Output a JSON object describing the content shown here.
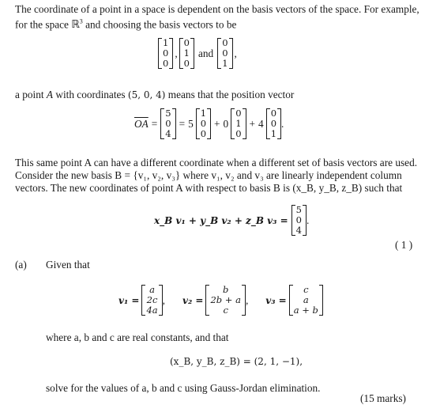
{
  "intro": {
    "line1": "The coordinate of a point in a space is dependent on the basis vectors of the space. For example,",
    "line2_a": "for the space ",
    "line2_space": "ℝ",
    "line2_sup": "3",
    "line2_b": " and choosing the basis vectors to be"
  },
  "basis_std": {
    "e1": [
      "1",
      "0",
      "0"
    ],
    "e2": [
      "0",
      "1",
      "0"
    ],
    "e3": [
      "0",
      "0",
      "1"
    ],
    "sep1": ",",
    "and": "and",
    "end": ","
  },
  "point_line": {
    "a": "a point ",
    "A": "A",
    "b": " with coordinates ",
    "coords": "(5, 0, 4)",
    "c": " means that the position vector"
  },
  "oa_eq": {
    "lhs": "OA",
    "vec": [
      "5",
      "0",
      "4"
    ],
    "coef1": "5",
    "coef2": "0",
    "coef3": "4",
    "e1": [
      "1",
      "0",
      "0"
    ],
    "e2": [
      "0",
      "1",
      "0"
    ],
    "e3": [
      "0",
      "0",
      "1"
    ]
  },
  "para2": {
    "line1": "This same point A can have a different coordinate when a different set of basis vectors are used.",
    "line2": "Consider the new basis B = {v₁, v₂, v₃} where v₁, v₂ and v₃ are linearly independent column",
    "line3": "vectors. The new coordinates of point A with respect to basis B is (x_B, y_B, z_B) such that"
  },
  "eq1": {
    "lhs": "x_B v₁ + y_B v₂ + z_B v₃ =",
    "rhs": [
      "5",
      "0",
      "4"
    ],
    "number": "( 1 )"
  },
  "part_a": {
    "label": "(a)",
    "given": "Given that",
    "v1_label": "v₁ =",
    "v1": [
      "a",
      "2c",
      "4a"
    ],
    "v2_label": "v₂ =",
    "v2": [
      "b",
      "2b + a",
      "c"
    ],
    "v3_label": "v₃ =",
    "v3": [
      "c",
      "a",
      "a + b"
    ],
    "where": "where a, b and c are real constants, and that",
    "coords_eq": "(x_B, y_B, z_B) = (2, 1, −1),",
    "solve": "solve for the values of a, b and c using Gauss-Jordan elimination.",
    "marks": "(15 marks)"
  }
}
